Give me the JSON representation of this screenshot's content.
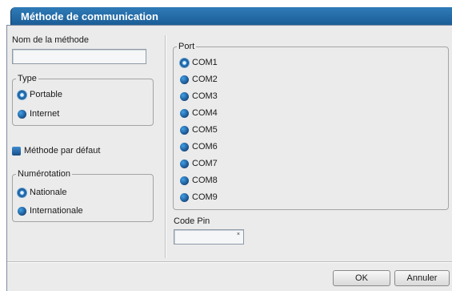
{
  "window": {
    "title": "Méthode de communication"
  },
  "method": {
    "name_label": "Nom de la méthode",
    "name_value": ""
  },
  "type": {
    "legend": "Type",
    "options": [
      {
        "label": "Portable",
        "selected": true
      },
      {
        "label": "Internet",
        "selected": false
      }
    ]
  },
  "default_method": {
    "label": "Méthode par défaut",
    "checked": true
  },
  "numerotation": {
    "legend": "Numérotation",
    "options": [
      {
        "label": "Nationale",
        "selected": true
      },
      {
        "label": "Internationale",
        "selected": false
      }
    ]
  },
  "port": {
    "legend": "Port",
    "options": [
      {
        "label": "COM1",
        "selected": true
      },
      {
        "label": "COM2",
        "selected": false
      },
      {
        "label": "COM3",
        "selected": false
      },
      {
        "label": "COM4",
        "selected": false
      },
      {
        "label": "COM5",
        "selected": false
      },
      {
        "label": "COM6",
        "selected": false
      },
      {
        "label": "COM7",
        "selected": false
      },
      {
        "label": "COM8",
        "selected": false
      },
      {
        "label": "COM9",
        "selected": false
      }
    ]
  },
  "pin": {
    "label": "Code Pin",
    "value": "",
    "mark": "×"
  },
  "buttons": {
    "ok": "OK",
    "cancel": "Annuler"
  },
  "colors": {
    "title_bar": "#2f7bb8",
    "panel": "#ebebeb",
    "radio": "#1a4e86"
  }
}
